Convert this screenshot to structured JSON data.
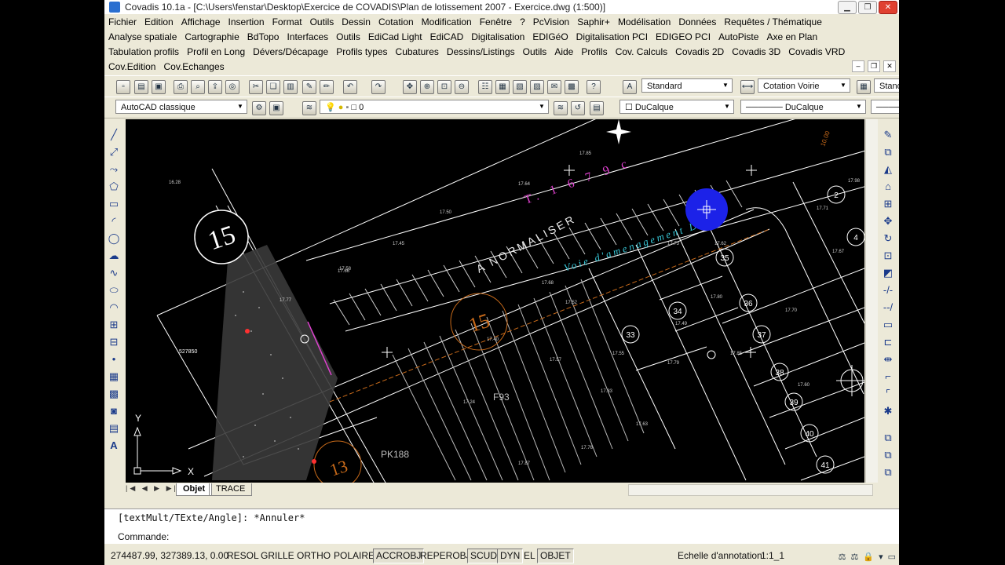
{
  "window": {
    "title": "Covadis 10.1a - [C:\\Users\\fenstar\\Desktop\\Exercice de COVADIS\\Plan de lotissement 2007 - Exercice.dwg (1:500)]",
    "minimize": "▁",
    "maximize": "❐",
    "close": "✕"
  },
  "menu_rows": [
    [
      "Fichier",
      "Edition",
      "Affichage",
      "Insertion",
      "Format",
      "Outils",
      "Dessin",
      "Cotation",
      "Modification",
      "Fenêtre",
      "?",
      "PcVision",
      "Saphir+",
      "Modélisation",
      "Données",
      "Requêtes / Thématique"
    ],
    [
      "Analyse spatiale",
      "Cartographie",
      "BdTopo",
      "Interfaces",
      "Outils",
      "EdiCad Light",
      "EdiCAD",
      "Digitalisation",
      "EDIGéO",
      "Digitalisation PCI",
      "EDIGEO PCI",
      "AutoPiste",
      "Axe en Plan"
    ],
    [
      "Tabulation profils",
      "Profil en Long",
      "Dévers/Décapage",
      "Profils types",
      "Cubatures",
      "Dessins/Listings",
      "Outils",
      "Aide",
      "Profils",
      "Cov. Calculs",
      "Covadis 2D",
      "Covadis 3D",
      "Covadis VRD"
    ],
    [
      "Cov.Edition",
      "Cov.Echanges"
    ]
  ],
  "toolbar": {
    "text_style": "Standard",
    "dim_style": "Cotation Voirie",
    "table_style": "Standa",
    "workspace": "AutoCAD classique",
    "layer": "0",
    "color": "DuCalque",
    "linetype": "DuCalque"
  },
  "drawing": {
    "parcel_big_15": "15",
    "parcel_15_orange": "15",
    "parcel_13": "13",
    "lots": [
      "2",
      "4",
      "33",
      "34",
      "35",
      "36",
      "37",
      "38",
      "39",
      "40",
      "41"
    ],
    "road_label": "Voie d'amenagement  DB 15",
    "anormaliser": "A NORMALISER",
    "cadastre": "T. 1 6 7 9 c",
    "f93": "F93",
    "pk188": "PK188",
    "left_label": "527850",
    "dim_top": "10.00",
    "elevations": [
      "16.28",
      "17.50",
      "17.45",
      "17.64",
      "17.58",
      "17.66",
      "17.77",
      "17.85",
      "17.68",
      "17.73",
      "17.40",
      "17.52",
      "17.57",
      "17.55",
      "17.49",
      "17.24",
      "17.76",
      "17.63",
      "17.79",
      "17.80",
      "17.85",
      "17.62",
      "17.70",
      "17.71",
      "17.67",
      "17.83",
      "17.87",
      "17.60",
      "17.98"
    ],
    "axis_y": "Y",
    "axis_x": "X"
  },
  "tabs": {
    "nav": "|◀ ◀ ▶ ▶|",
    "model": "Objet",
    "layout": "TRACE"
  },
  "command": {
    "history": "[textMult/TExte/Angle]: *Annuler*",
    "prompt": "Commande:"
  },
  "status": {
    "coords": "274487.99, 327389.13, 0.00",
    "toggles": [
      {
        "label": "RESOL",
        "on": false
      },
      {
        "label": "GRILLE",
        "on": false
      },
      {
        "label": "ORTHO",
        "on": false
      },
      {
        "label": "POLAIRE",
        "on": false
      },
      {
        "label": "ACCROBJ",
        "on": true
      },
      {
        "label": "REPEROBJ",
        "on": false
      },
      {
        "label": "SCUD",
        "on": true
      },
      {
        "label": "DYN",
        "on": true
      },
      {
        "label": "EL",
        "on": false
      },
      {
        "label": "OBJET",
        "on": true
      }
    ],
    "annotation_scale_label": "Echelle d'annotation:",
    "annotation_scale": "1:1_1"
  }
}
